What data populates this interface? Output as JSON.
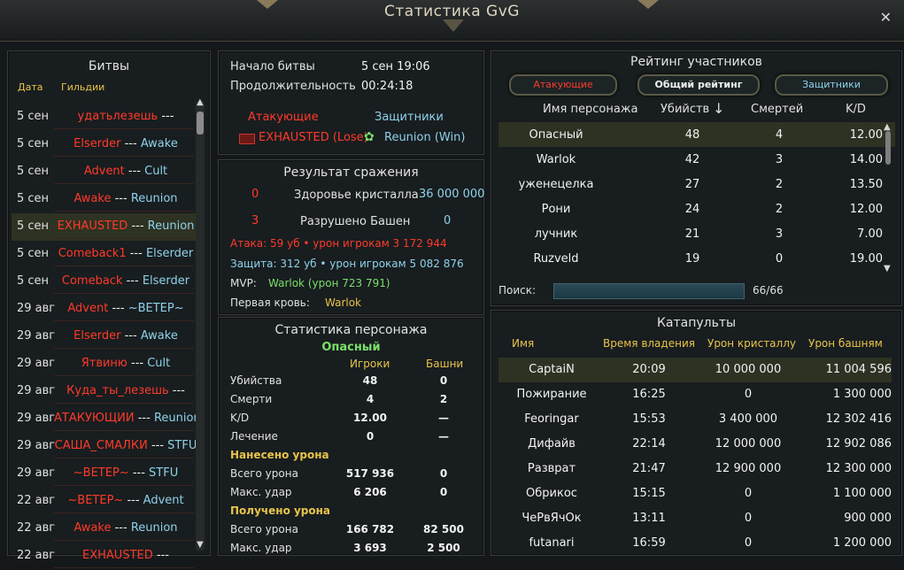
{
  "window": {
    "title": "Статистика GvG",
    "close": "✕"
  },
  "battles": {
    "title": "Битвы",
    "col_date": "Дата",
    "col_guilds": "Гильдии",
    "rows": [
      {
        "date": "5 сен",
        "a": "удатьлезешь",
        "sep": "---",
        "d": ""
      },
      {
        "date": "5 сен",
        "a": "Elserder",
        "sep": "---",
        "d": "Awake"
      },
      {
        "date": "5 сен",
        "a": "Advent",
        "sep": "---",
        "d": "Cult"
      },
      {
        "date": "5 сен",
        "a": "Awake",
        "sep": "---",
        "d": "Reunion"
      },
      {
        "date": "5 сен",
        "a": "EXHAUSTED",
        "sep": "---",
        "d": "Reunion"
      },
      {
        "date": "5 сен",
        "a": "Comeback1",
        "sep": "---",
        "d": "Elserder"
      },
      {
        "date": "5 сен",
        "a": "Comeback",
        "sep": "---",
        "d": "Elserder"
      },
      {
        "date": "29 авг",
        "a": "Advent",
        "sep": "---",
        "d": "~ВЕТЕР~"
      },
      {
        "date": "29 авг",
        "a": "Elserder",
        "sep": "---",
        "d": "Awake"
      },
      {
        "date": "29 авг",
        "a": "Ятвиню",
        "sep": "---",
        "d": "Cult"
      },
      {
        "date": "29 авг",
        "a": "Куда_ты_лезешь",
        "sep": "---",
        "d": ""
      },
      {
        "date": "29 авг",
        "a": "АТАКУЮЩИЙ",
        "sep": "---",
        "d": "Reunion"
      },
      {
        "date": "29 авг",
        "a": "САША_СМАЛКИ",
        "sep": "---",
        "d": "STFU"
      },
      {
        "date": "29 авг",
        "a": "~ВЕТЕР~",
        "sep": "---",
        "d": "STFU"
      },
      {
        "date": "22 авг",
        "a": "~ВЕТЕР~",
        "sep": "---",
        "d": "Advent"
      },
      {
        "date": "22 авг",
        "a": "Awake",
        "sep": "---",
        "d": "Reunion"
      },
      {
        "date": "22 авг",
        "a": "EXHAUSTED",
        "sep": "---",
        "d": ""
      }
    ]
  },
  "info": {
    "start_label": "Начало битвы",
    "start_value": "5 сен 19:06",
    "duration_label": "Продолжительность",
    "duration_value": "00:24:18",
    "attackers_label": "Атакующие",
    "defenders_label": "Защитники",
    "attacker_result": "EXHAUSTED (Lose)",
    "defender_result": "Reunion (Win)"
  },
  "result": {
    "title": "Результат сражения",
    "crystal_left": "0",
    "crystal_label": "Здоровье кристалла",
    "crystal_value": "36 000 000",
    "towers_left": "3",
    "towers_label": "Разрушено Башен",
    "towers_value": "0",
    "attack_line": "Атака:   59 уб  •  урон игрокам 3 172 944",
    "defense_line": "Защита: 312 уб  •  урон игрокам 5 082 876",
    "mvp_label": "MVP:",
    "mvp_value": "Warlok (урон 723 791)",
    "first_blood_label": "Первая кровь:",
    "first_blood_value": "Warlok"
  },
  "char_stats": {
    "title": "Статистика персонажа",
    "name": "Опасный",
    "col_players": "Игроки",
    "col_towers": "Башни",
    "rows": [
      {
        "label": "Убийства",
        "p": "48",
        "t": "0"
      },
      {
        "label": "Смерти",
        "p": "4",
        "t": "2"
      },
      {
        "label": "K/D",
        "p": "12.00",
        "t": "—"
      },
      {
        "label": "Лечение",
        "p": "0",
        "t": "—"
      }
    ],
    "dealt_title": "Нанесено урона",
    "dealt_rows": [
      {
        "label": "Всего урона",
        "p": "517 936",
        "t": "0"
      },
      {
        "label": "Макс. удар",
        "p": "6 206",
        "t": "0"
      }
    ],
    "received_title": "Получено урона",
    "received_rows": [
      {
        "label": "Всего урона",
        "p": "166 782",
        "t": "82 500"
      },
      {
        "label": "Макс. удар",
        "p": "3 693",
        "t": "2 500"
      }
    ]
  },
  "rating": {
    "title": "Рейтинг участников",
    "tabs": [
      "Атакующие",
      "Общий рейтинг",
      "Защитники"
    ],
    "col_name": "Имя персонажа",
    "col_kills": "Убийств",
    "col_deaths": "Смертей",
    "col_kd": "K/D",
    "sort_icon": "↓",
    "rows": [
      {
        "name": "Опасный",
        "kills": "48",
        "deaths": "4",
        "kd": "12.00"
      },
      {
        "name": "Warlok",
        "kills": "42",
        "deaths": "3",
        "kd": "14.00"
      },
      {
        "name": "уженецелка",
        "kills": "27",
        "deaths": "2",
        "kd": "13.50"
      },
      {
        "name": "Рони",
        "kills": "24",
        "deaths": "2",
        "kd": "12.00"
      },
      {
        "name": "лучник",
        "kills": "21",
        "deaths": "3",
        "kd": "7.00"
      },
      {
        "name": "Ruzveld",
        "kills": "19",
        "deaths": "0",
        "kd": "19.00"
      }
    ],
    "search_label": "Поиск:",
    "count": "66/66"
  },
  "catapults": {
    "title": "Катапульты",
    "col_name": "Имя",
    "col_time": "Время владения",
    "col_crystal": "Урон кристаллу",
    "col_towers": "Урон башням",
    "rows": [
      {
        "name": "CaptaiN",
        "time": "20:09",
        "crystal": "10 000 000",
        "towers": "11 004 596"
      },
      {
        "name": "Пожирание",
        "time": "16:25",
        "crystal": "0",
        "towers": "1 300 000"
      },
      {
        "name": "Feoringar",
        "time": "15:53",
        "crystal": "3 400 000",
        "towers": "12 302 416"
      },
      {
        "name": "Дифайв",
        "time": "22:14",
        "crystal": "12 000 000",
        "towers": "12 902 086"
      },
      {
        "name": "Разврат",
        "time": "21:47",
        "crystal": "12 900 000",
        "towers": "12 300 000"
      },
      {
        "name": "Обрикос",
        "time": "15:15",
        "crystal": "0",
        "towers": "1 100 000"
      },
      {
        "name": "ЧеРвЯчОк",
        "time": "13:11",
        "crystal": "0",
        "towers": "900 000"
      },
      {
        "name": "futanari",
        "time": "16:59",
        "crystal": "0",
        "towers": "1 200 000"
      }
    ]
  }
}
